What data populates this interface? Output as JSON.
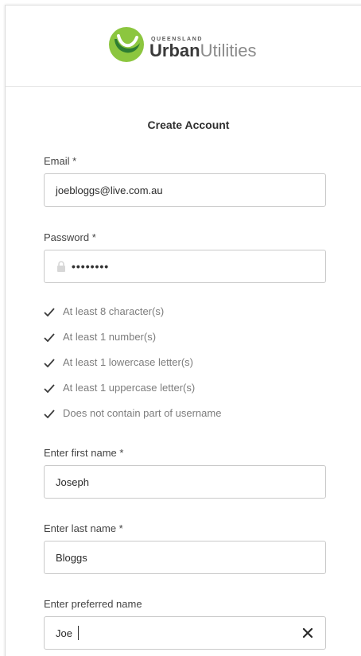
{
  "brand": {
    "small_text": "QUEENSLAND",
    "word_bold": "Urban",
    "word_light": "Utilities",
    "green": "#79b82a",
    "dark_green": "#2e7d32"
  },
  "form": {
    "title": "Create Account",
    "email": {
      "label": "Email *",
      "value": "joebloggs@live.com.au"
    },
    "password": {
      "label": "Password *",
      "masked_value": "••••••••",
      "icon": "lock-icon"
    },
    "rules": [
      {
        "text": "At least 8 character(s)",
        "icon": "check-icon"
      },
      {
        "text": "At least 1 number(s)",
        "icon": "check-icon"
      },
      {
        "text": "At least 1 lowercase letter(s)",
        "icon": "check-icon"
      },
      {
        "text": "At least 1 uppercase letter(s)",
        "icon": "check-icon"
      },
      {
        "text": "Does not contain part of username",
        "icon": "check-icon"
      }
    ],
    "first_name": {
      "label": "Enter first name *",
      "value": "Joseph"
    },
    "last_name": {
      "label": "Enter last name *",
      "value": "Bloggs"
    },
    "preferred_name": {
      "label": "Enter preferred name",
      "value": "Joe",
      "clear_icon": "close-icon"
    }
  }
}
